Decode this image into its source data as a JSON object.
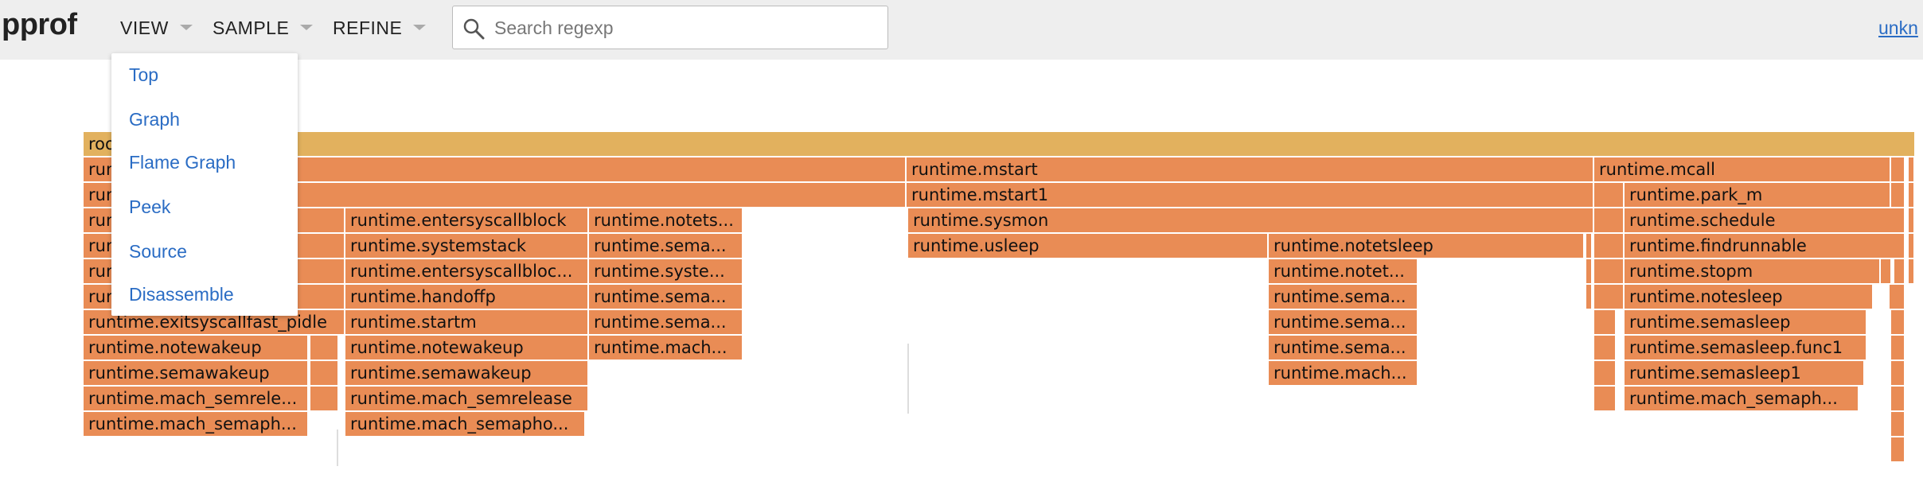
{
  "colors": {
    "accent": "#2a6cc4",
    "root": "#e2b15e",
    "frame": "#e98c55",
    "header_bg": "#eeeeee"
  },
  "header": {
    "logo": "pprof",
    "menus": [
      {
        "label": "VIEW"
      },
      {
        "label": "SAMPLE"
      },
      {
        "label": "REFINE"
      }
    ],
    "search": {
      "placeholder": "Search regexp",
      "value": "",
      "icon": "search-icon"
    },
    "user_link": "unkn"
  },
  "view_menu": {
    "items": [
      "Top",
      "Graph",
      "Flame Graph",
      "Peek",
      "Source",
      "Disassemble"
    ]
  },
  "flame": {
    "frames": [
      {
        "label": "root"
      },
      {
        "label": "runtime.mstart"
      },
      {
        "label": "runtime.mcall"
      },
      {
        "label": "runtime.mstart1"
      },
      {
        "label": "runtime.park_m"
      },
      {
        "label": "runtime.entersyscallblock"
      },
      {
        "label": "runtime.notets..."
      },
      {
        "label": "runtime.sysmon"
      },
      {
        "label": "runtime.schedule"
      },
      {
        "label": "runtime.systemstack"
      },
      {
        "label": "runtime.sema..."
      },
      {
        "label": "runtime.usleep"
      },
      {
        "label": "runtime.notetsleep"
      },
      {
        "label": "runtime.findrunnable"
      },
      {
        "label": "runtime.entersyscallbloc..."
      },
      {
        "label": "runtime.syste..."
      },
      {
        "label": "runtime.notet..."
      },
      {
        "label": "runtime.stopm"
      },
      {
        "label": "runtime.handoffp"
      },
      {
        "label": "runtime.sema..."
      },
      {
        "label": "runtime.sema..."
      },
      {
        "label": "runtime.notesleep"
      },
      {
        "label": "runtime.exitsyscallfast_pidle"
      },
      {
        "label": "runtime.startm"
      },
      {
        "label": "runtime.sema..."
      },
      {
        "label": "runtime.sema..."
      },
      {
        "label": "runtime.semasleep"
      },
      {
        "label": "runtime.notewakeup"
      },
      {
        "label": "runtime.notewakeup"
      },
      {
        "label": "runtime.mach..."
      },
      {
        "label": "runtime.sema..."
      },
      {
        "label": "runtime.semasleep.func1"
      },
      {
        "label": "runtime.semawakeup"
      },
      {
        "label": "runtime.semawakeup"
      },
      {
        "label": "runtime.mach..."
      },
      {
        "label": "runtime.semasleep1"
      },
      {
        "label": "runtime.mach_semrele..."
      },
      {
        "label": "runtime.mach_semrelease"
      },
      {
        "label": "runtime.mach_semaph..."
      },
      {
        "label": "runtime.mach_semaph..."
      },
      {
        "label": "runtime.mach_semapho..."
      },
      {
        "label": "runtime.run"
      },
      {
        "label": "runtime.run"
      },
      {
        "label": "runtime.run"
      },
      {
        "label": "runtime.run"
      },
      {
        "label": "runtime.run"
      },
      {
        "label": "runtime.runun..."
      },
      {
        "label": ""
      },
      {
        "label": ""
      },
      {
        "label": ""
      },
      {
        "label": ""
      },
      {
        "label": ""
      },
      {
        "label": ""
      },
      {
        "label": ""
      },
      {
        "label": ""
      },
      {
        "label": ""
      },
      {
        "label": ""
      },
      {
        "label": ""
      },
      {
        "label": ""
      },
      {
        "label": ""
      },
      {
        "label": ""
      },
      {
        "label": ""
      },
      {
        "label": ""
      },
      {
        "label": ""
      },
      {
        "label": ""
      },
      {
        "label": ""
      },
      {
        "label": ""
      },
      {
        "label": ""
      },
      {
        "label": ""
      },
      {
        "label": ""
      },
      {
        "label": ""
      },
      {
        "label": ""
      },
      {
        "label": ""
      },
      {
        "label": ""
      },
      {
        "label": ""
      }
    ]
  }
}
